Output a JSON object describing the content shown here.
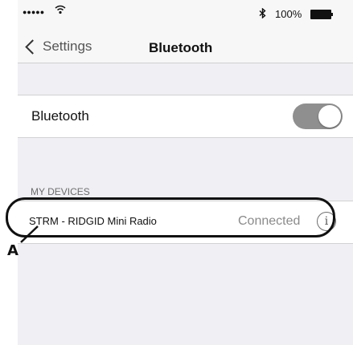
{
  "status_bar": {
    "signal": "●●●●● ",
    "wifi_icon": "wifi-icon",
    "bluetooth_icon": "bluetooth-icon",
    "battery_percent": "100%"
  },
  "nav": {
    "back_label": "Settings",
    "title": "Bluetooth"
  },
  "bluetooth_row": {
    "label": "Bluetooth",
    "toggle_on": true,
    "toggle_color": "#8f8f8f"
  },
  "my_devices": {
    "header": "MY DEVICES",
    "devices": [
      {
        "name": "STRM - RIDGID Mini Radio",
        "status": "Connected",
        "info_symbol": "i"
      }
    ]
  },
  "annotation": {
    "label": "A"
  }
}
